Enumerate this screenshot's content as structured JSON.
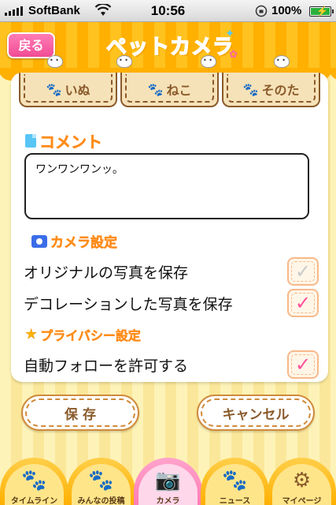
{
  "status_bar": {
    "carrier": "SoftBank",
    "time": "10:56",
    "battery_percent": "100%"
  },
  "header": {
    "back_label": "戻る",
    "logo_text": "ペットカメラ"
  },
  "pet_tabs": [
    {
      "label": "いぬ",
      "icon": "dog-icon"
    },
    {
      "label": "ねこ",
      "icon": "cat-icon"
    },
    {
      "label": "そのた",
      "icon": "other-pet-icon"
    }
  ],
  "comment": {
    "title": "コメント",
    "value": "ワンワンワンッ。"
  },
  "camera_settings": {
    "title": "カメラ設定",
    "save_original_label": "オリジナルの写真を保存",
    "save_original_checked": false,
    "save_decorated_label": "デコレーションした写真を保存",
    "save_decorated_checked": true
  },
  "privacy_settings": {
    "title": "プライバシー設定",
    "auto_follow_label": "自動フォローを許可する",
    "auto_follow_checked": true
  },
  "actions": {
    "save_label": "保 存",
    "cancel_label": "キャンセル"
  },
  "tab_bar": {
    "items": [
      {
        "label": "タイムライン",
        "icon": "timeline-icon"
      },
      {
        "label": "みんなの投稿",
        "icon": "everyone-posts-icon"
      },
      {
        "label": "カメラ",
        "icon": "camera-icon",
        "active": true
      },
      {
        "label": "ニュース",
        "icon": "news-icon"
      },
      {
        "label": "マイページ",
        "icon": "mypage-icon"
      }
    ]
  },
  "colors": {
    "accent_orange": "#ffb000",
    "accent_pink": "#ff4f9a",
    "section_title": "#ff8c1a",
    "brown": "#8a5a2b"
  }
}
